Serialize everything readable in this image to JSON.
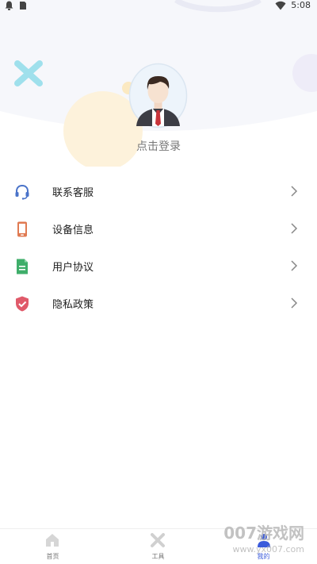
{
  "status_bar": {
    "time": "5:08"
  },
  "profile": {
    "login_text": "点击登录"
  },
  "menu": [
    {
      "label": "联系客服",
      "icon": "headset-icon",
      "color": "#4a73c9"
    },
    {
      "label": "设备信息",
      "icon": "phone-icon",
      "color": "#e07a52"
    },
    {
      "label": "用户协议",
      "icon": "document-icon",
      "color": "#3fae6a"
    },
    {
      "label": "隐私政策",
      "icon": "shield-check-icon",
      "color": "#e05a6a"
    }
  ],
  "tabbar": {
    "tabs": [
      {
        "label": "首页",
        "icon": "home-icon"
      },
      {
        "label": "工具",
        "icon": "tools-icon"
      },
      {
        "label": "我的",
        "icon": "user-icon",
        "active": true
      }
    ],
    "active_color": "#3b5bdb"
  },
  "watermark": {
    "brand": "007游戏网",
    "url": "www.yx007.com"
  }
}
